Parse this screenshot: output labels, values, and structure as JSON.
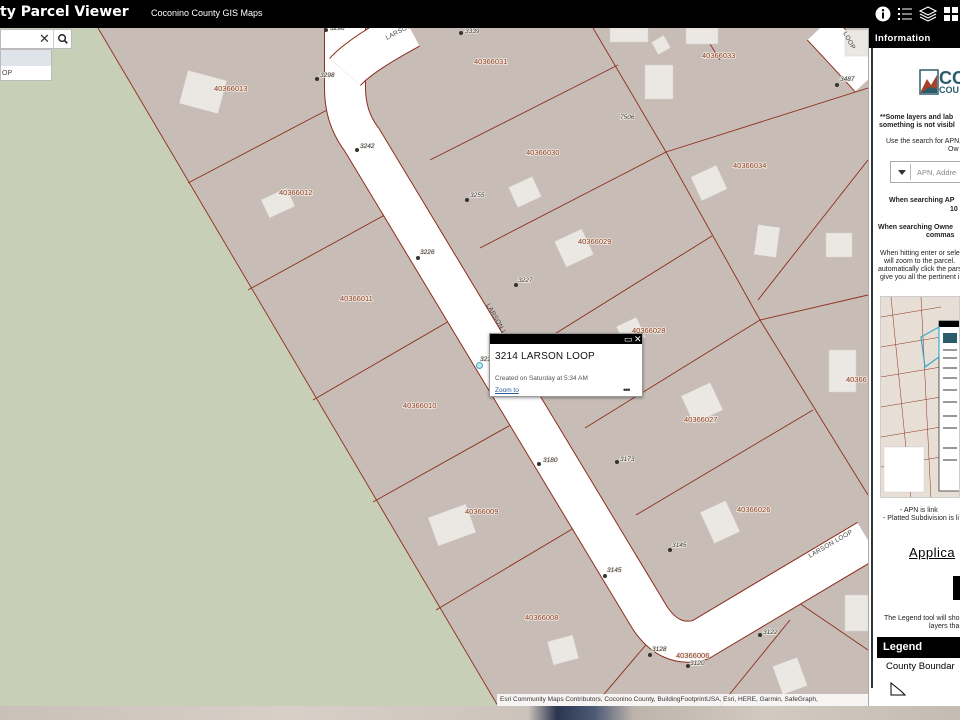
{
  "header": {
    "title": "ty Parcel Viewer",
    "subtitle": "Coconino County GIS Maps",
    "icons": [
      "info-icon",
      "legend-list-icon",
      "layers-icon",
      "grid-icon"
    ]
  },
  "search": {
    "value": "",
    "suggestion_text": "OP"
  },
  "map": {
    "road_name": "LARSON LOOP",
    "road_labels": [
      "LARSON LOOP",
      "LARSON LO",
      "LARSON LOOP",
      "LOOP"
    ],
    "parcel_labels": [
      "40366013",
      "40366031",
      "40366033",
      "40366030",
      "40366012",
      "40366034",
      "40366029",
      "40366011",
      "40366028",
      "40366010",
      "40366027",
      "40366009",
      "40366026",
      "40366008",
      "40366006",
      "40366"
    ],
    "address_labels": [
      "3296",
      "3339",
      "3298",
      "3242",
      "3255",
      "3226",
      "3227",
      "3173",
      "3180",
      "3145",
      "3145",
      "3128",
      "3120",
      "3122",
      "3487",
      "3214",
      "7506"
    ],
    "attribution": "Esri Community Maps Contributors, Coconino County, BuildingFootprintUSA, Esri, HERE, Garmin, SafeGraph,"
  },
  "popup": {
    "title": "3214 LARSON LOOP",
    "created": "Created on Saturday at 5:34 AM",
    "zoom_label": "Zoom to",
    "more_label": "•••"
  },
  "panel": {
    "title": "Information",
    "logo_line1": "CO",
    "logo_line2": "COU",
    "note1": "**Some layers and lab",
    "note2": "something is not visibl",
    "use_search1": "Use the search for APN,",
    "use_search2": "Ow",
    "select_placeholder": "APN, Addre",
    "when_apn1": "When searching AP",
    "when_apn2": "10",
    "when_owner1": "When searching Owne",
    "when_owner2": "commas",
    "hit1": "When hitting enter or sele",
    "hit2": "will zoom to the parcel.",
    "hit3": "automatically click the pars",
    "hit4": "give you all the pertinent i",
    "apn_link": "- APN is link",
    "platted": "- Platted Subdivision is li",
    "applic": "Applica",
    "legend_tool1": "The Legend tool will sho",
    "legend_tool2": "layers tha",
    "legend_title": "Legend",
    "legend_item": "County Boundar"
  },
  "colors": {
    "parcel_fill": "#c8bcb6",
    "parcel_line": "#8c2f1c",
    "vacant_land": "#c7cfb7",
    "road": "#ffffff",
    "accent": "#39a9c8"
  }
}
